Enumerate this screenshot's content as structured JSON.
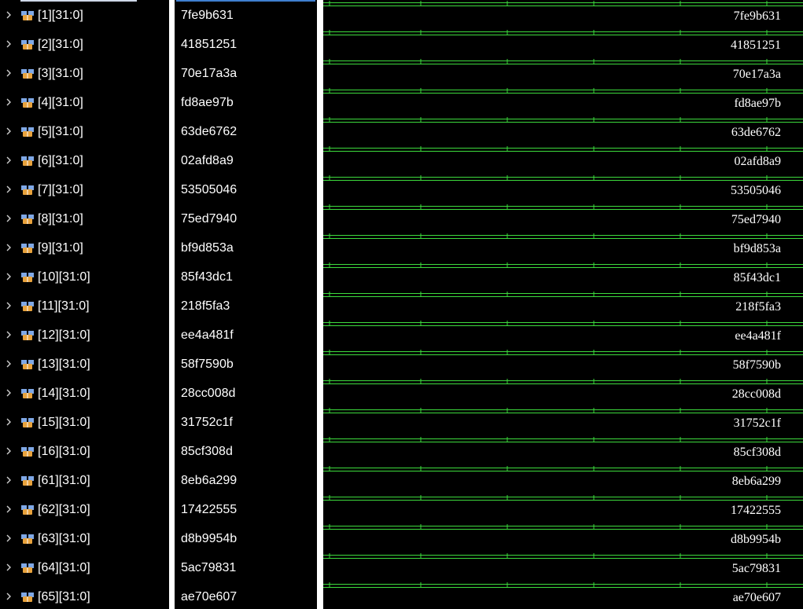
{
  "colors": {
    "background": "#000000",
    "text": "#ffffff",
    "waveform": "#3ddc3d",
    "separator": "#ffffff",
    "name_header_accent": "#cfd8e8",
    "value_header_accent": "#3f7fd0"
  },
  "icons": {
    "expand": "chevron-right-icon",
    "signal": "bus-signal-icon"
  },
  "signals": [
    {
      "name": "[1][31:0]",
      "value": "7fe9b631",
      "wave_value": "7fe9b631"
    },
    {
      "name": "[2][31:0]",
      "value": "41851251",
      "wave_value": "41851251"
    },
    {
      "name": "[3][31:0]",
      "value": "70e17a3a",
      "wave_value": "70e17a3a"
    },
    {
      "name": "[4][31:0]",
      "value": "fd8ae97b",
      "wave_value": "fd8ae97b"
    },
    {
      "name": "[5][31:0]",
      "value": "63de6762",
      "wave_value": "63de6762"
    },
    {
      "name": "[6][31:0]",
      "value": "02afd8a9",
      "wave_value": "02afd8a9"
    },
    {
      "name": "[7][31:0]",
      "value": "53505046",
      "wave_value": "53505046"
    },
    {
      "name": "[8][31:0]",
      "value": "75ed7940",
      "wave_value": "75ed7940"
    },
    {
      "name": "[9][31:0]",
      "value": "bf9d853a",
      "wave_value": "bf9d853a"
    },
    {
      "name": "[10][31:0]",
      "value": "85f43dc1",
      "wave_value": "85f43dc1"
    },
    {
      "name": "[11][31:0]",
      "value": "218f5fa3",
      "wave_value": "218f5fa3"
    },
    {
      "name": "[12][31:0]",
      "value": "ee4a481f",
      "wave_value": "ee4a481f"
    },
    {
      "name": "[13][31:0]",
      "value": "58f7590b",
      "wave_value": "58f7590b"
    },
    {
      "name": "[14][31:0]",
      "value": "28cc008d",
      "wave_value": "28cc008d"
    },
    {
      "name": "[15][31:0]",
      "value": "31752c1f",
      "wave_value": "31752c1f"
    },
    {
      "name": "[16][31:0]",
      "value": "85cf308d",
      "wave_value": "85cf308d"
    },
    {
      "name": "[61][31:0]",
      "value": "8eb6a299",
      "wave_value": "8eb6a299"
    },
    {
      "name": "[62][31:0]",
      "value": "17422555",
      "wave_value": "17422555"
    },
    {
      "name": "[63][31:0]",
      "value": "d8b9954b",
      "wave_value": "d8b9954b"
    },
    {
      "name": "[64][31:0]",
      "value": "5ac79831",
      "wave_value": "5ac79831"
    },
    {
      "name": "[65][31:0]",
      "value": "ae70e607",
      "wave_value": "ae70e607"
    }
  ]
}
